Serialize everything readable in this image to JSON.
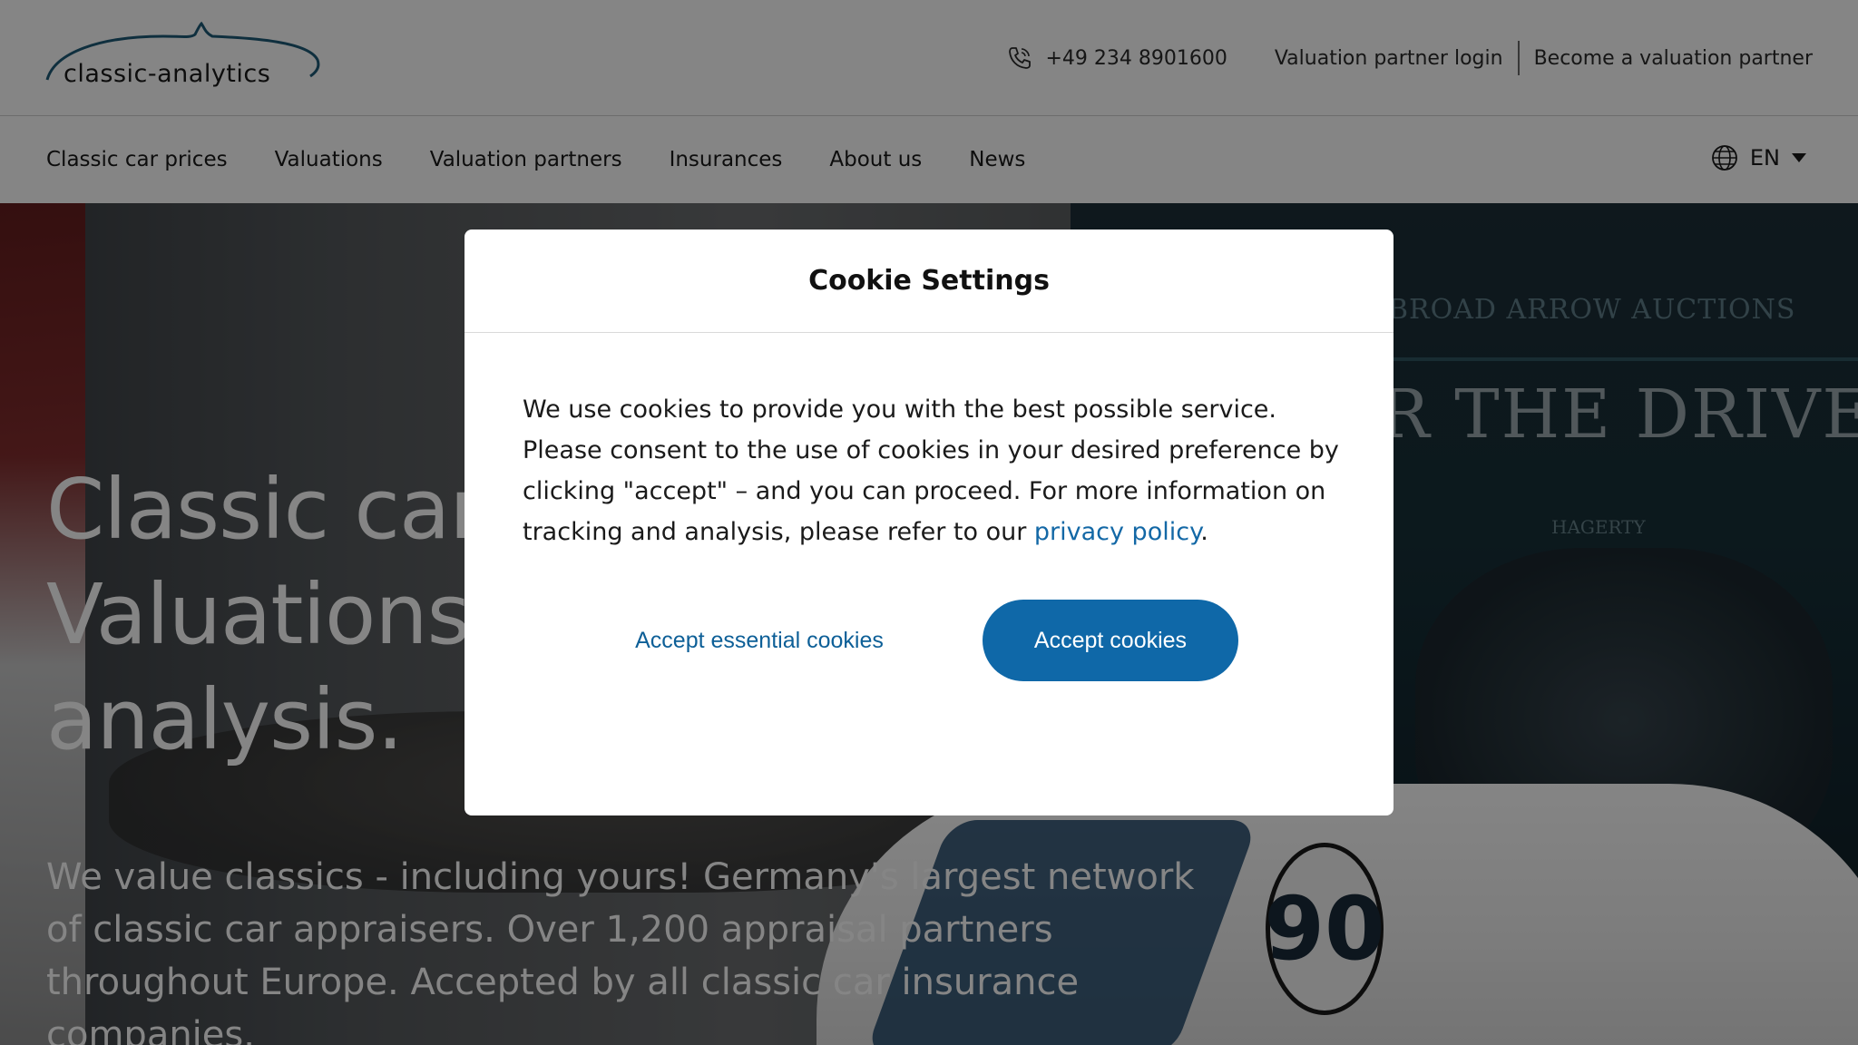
{
  "header": {
    "logo_text": "classic-analytics",
    "phone": "+49 234 8901600",
    "phone_icon": "phone-icon",
    "links": [
      "Valuation partner login",
      "Become a valuation partner"
    ]
  },
  "nav": {
    "items": [
      "Classic car prices",
      "Valuations",
      "Valuation partners",
      "Insurances",
      "About us",
      "News"
    ],
    "language": "EN",
    "language_icon": "globe-icon"
  },
  "hero": {
    "title_lines": [
      "Classic car",
      "Valuations.",
      "analysis."
    ],
    "subtitle": "We value classics - including yours! Germany's largest network of classic car appraisers. Over 1,200 appraisal partners throughout Europe. Accepted by all classic car insurance companies.",
    "background": {
      "banner_top": "BROAD ARROW AUCTIONS",
      "banner_main": "R THE DRIVE",
      "banner_small": "HAGERTY",
      "car_number": "90"
    }
  },
  "cookie_modal": {
    "title": "Cookie Settings",
    "body_before_link": "We use cookies to provide you with the best possible service. Please consent to the use of cookies in your desired preference by clicking \"accept\" – and you can proceed. For more information on tracking and analysis, please refer to our ",
    "link_text": "privacy policy",
    "body_after_link": ".",
    "essential_button": "Accept essential cookies",
    "accept_button": "Accept cookies"
  },
  "colors": {
    "primary": "#0f68a8",
    "link": "#1368a6",
    "overlay": "rgba(0,0,0,0.48)",
    "logo_arc": "#1d5a78"
  }
}
